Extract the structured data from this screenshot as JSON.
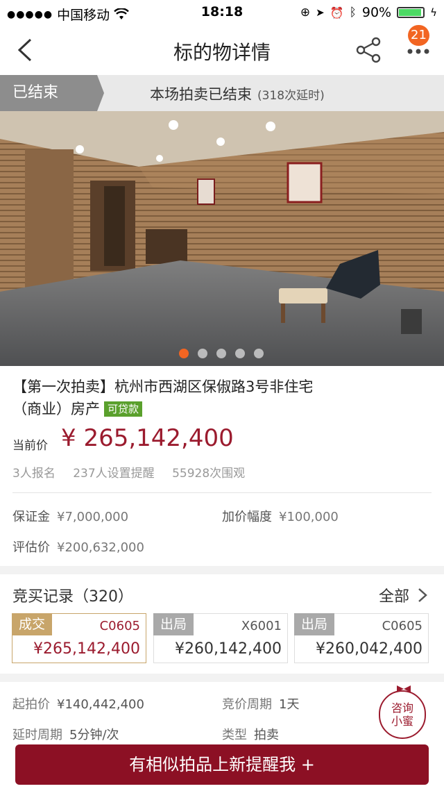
{
  "status_bar": {
    "carrier": "中国移动",
    "time": "18:18",
    "battery": "90%"
  },
  "nav": {
    "title": "标的物详情",
    "badge": "21"
  },
  "auction_status": {
    "tag": "已结束",
    "message": "本场拍卖已结束",
    "extensions": "(318次延时)"
  },
  "gallery": {
    "count": 5,
    "active": 1
  },
  "item": {
    "title": "【第一次拍卖】杭州市西湖区保俶路3号非住宅（商业）房产",
    "loan_badge": "可贷款",
    "price_label": "当前价",
    "price": "¥ 265,142,400",
    "signups": "3人报名",
    "reminders": "237人设置提醒",
    "views": "55928次围观",
    "deposit_label": "保证金",
    "deposit": "¥7,000,000",
    "increment_label": "加价幅度",
    "increment": "¥100,000",
    "appraisal_label": "评估价",
    "appraisal": "¥200,632,000"
  },
  "bids": {
    "header": "竞买记录（320）",
    "all_label": "全部",
    "records": [
      {
        "status": "成交",
        "code": "C0605",
        "amount": "¥265,142,400",
        "color": "#c8a56a"
      },
      {
        "status": "出局",
        "code": "X6001",
        "amount": "¥260,142,400",
        "color": "#a9a9a9"
      },
      {
        "status": "出局",
        "code": "C0605",
        "amount": "¥260,042,400",
        "color": "#a9a9a9"
      }
    ]
  },
  "details": {
    "start_price_label": "起拍价",
    "start_price": "¥140,442,400",
    "cycle_label": "竞价周期",
    "cycle": "1天",
    "delay_label": "延时周期",
    "delay": "5分钟/次",
    "type_label": "类型",
    "type": "拍卖"
  },
  "consult": {
    "line1": "咨询",
    "line2": "小蜜"
  },
  "cta": {
    "label": "有相似拍品上新提醒我 +"
  },
  "colors": {
    "accent": "#9b1b2e",
    "orange": "#f26522",
    "loan_green": "#5aa02c"
  }
}
